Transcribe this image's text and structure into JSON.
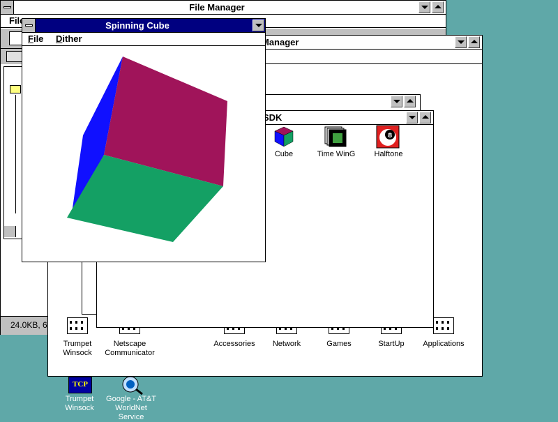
{
  "file_manager": {
    "title": "File Manager",
    "menu_first": "File",
    "status": "24.0KB, 6"
  },
  "program_manager": {
    "title": "Manager",
    "groups": [
      {
        "label": "Trumpet Winsock"
      },
      {
        "label": "Netscape Communicator"
      },
      {
        "label": "Accessories"
      },
      {
        "label": "Network"
      },
      {
        "label": "Games"
      },
      {
        "label": "StartUp"
      },
      {
        "label": "Applications"
      }
    ]
  },
  "sdk_window": {
    "title": "SDK",
    "items": [
      {
        "label": "Cube",
        "icon": "cube-icon"
      },
      {
        "label": "Time WinG",
        "icon": "time-wing-icon"
      },
      {
        "label": "Halftone",
        "icon": "halftone-icon"
      }
    ]
  },
  "spinning_cube": {
    "title": "Spinning Cube",
    "menu": [
      {
        "label": "File"
      },
      {
        "label": "Dither"
      }
    ],
    "colors": {
      "top": "#a0145a",
      "left": "#1010ff",
      "front": "#14a064"
    }
  },
  "desktop": {
    "icons": [
      {
        "label": "Trumpet Winsock",
        "icon_text": "TCP"
      },
      {
        "label": "Google - AT&T WorldNet Service"
      }
    ]
  },
  "colors": {
    "desktop": "#5fa8a8",
    "active_title": "#000080"
  }
}
